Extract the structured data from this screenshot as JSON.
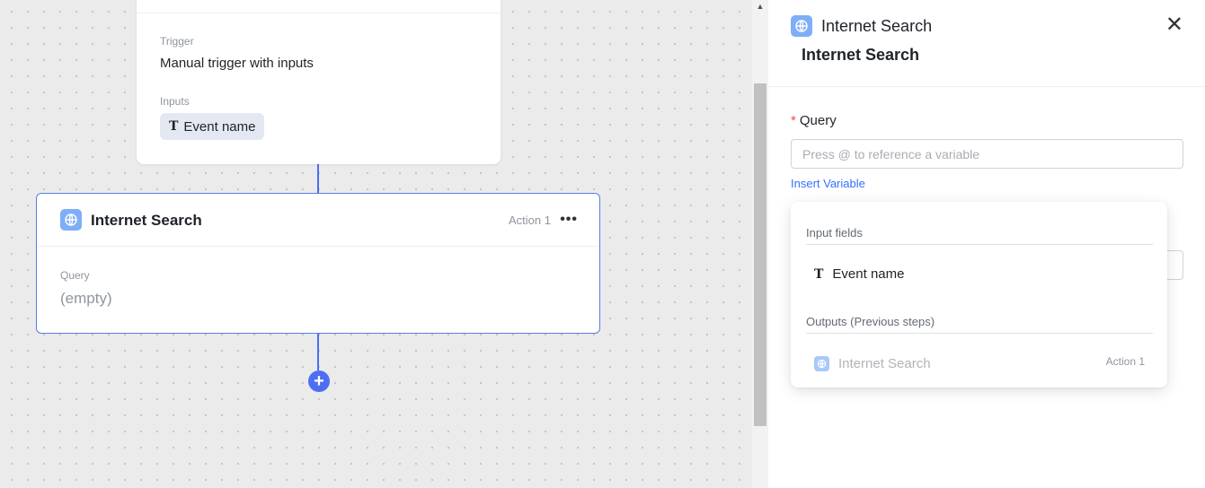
{
  "canvas": {
    "trigger_card": {
      "trigger_label": "Trigger",
      "trigger_value": "Manual trigger with inputs",
      "inputs_label": "Inputs",
      "input_chip": "Event name"
    },
    "action_card": {
      "title": "Internet Search",
      "badge": "Action 1",
      "more": "•••",
      "query_label": "Query",
      "query_value": "(empty)"
    },
    "add_button": "+"
  },
  "panel": {
    "title": "Internet Search",
    "subtitle": "Internet Search",
    "close": "✕",
    "query_label": "Query",
    "required_mark": "*",
    "query_placeholder": "Press @ to reference a variable",
    "insert_variable": "Insert Variable"
  },
  "popover": {
    "input_fields_title": "Input fields",
    "input_fields": [
      {
        "label": "Event name",
        "type_glyph": "T"
      }
    ],
    "outputs_title": "Outputs (Previous steps)",
    "outputs": [
      {
        "label": "Internet Search",
        "meta": "Action 1"
      }
    ]
  },
  "colors": {
    "accent": "#4e6ef2",
    "link": "#3370ff",
    "required": "#f54a45",
    "app_icon": "#7eaef8"
  }
}
